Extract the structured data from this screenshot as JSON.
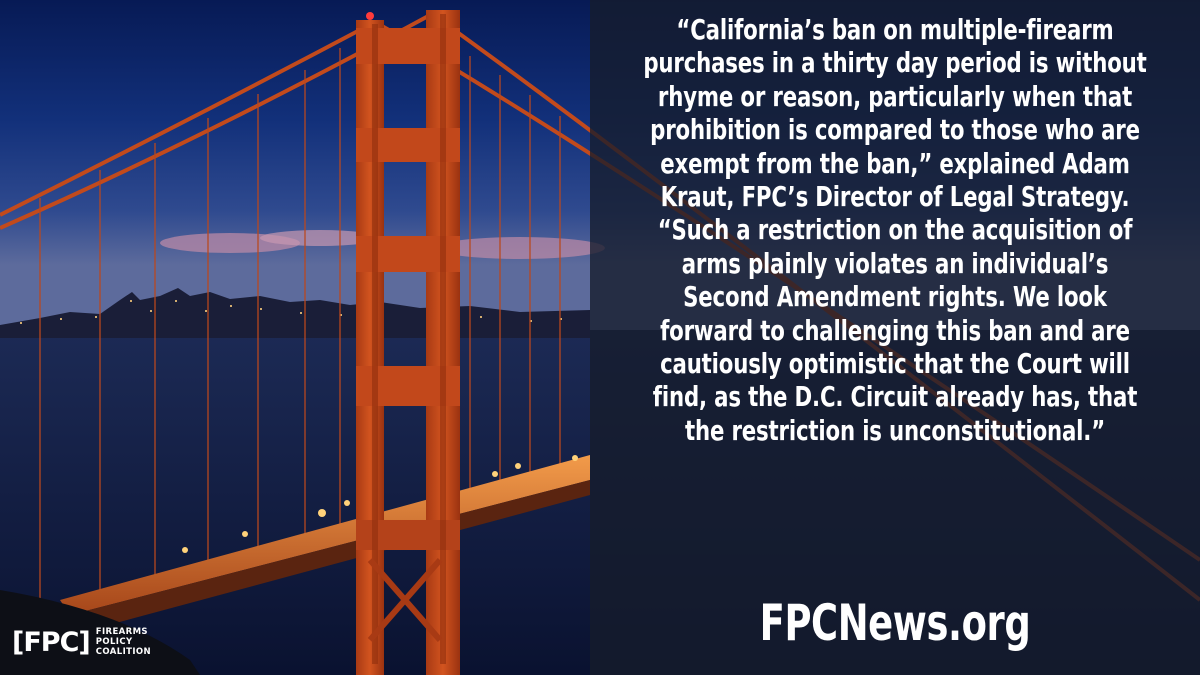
{
  "quote": {
    "text": "“California’s ban on multiple-firearm purchases in a thirty day period is without rhyme or reason, particularly when that prohibition is compared to those who are exempt from the ban,” explained Adam Kraut, FPC’s Director of Legal Strategy. “Such a restriction on the acquisition of arms plainly violates an individual’s Second Amendment rights. We look forward to challenging this ban and are cautiously optimistic that the Court will find, as the D.C. Circuit already has, that the restriction is unconstitutional.”"
  },
  "website": "FPCNews.org",
  "logo": {
    "mark": "[FPC]",
    "line1": "FIREARMS",
    "line2": "POLICY",
    "line3": "COALITION"
  },
  "colors": {
    "sky_top": "#0a1f5c",
    "sky_bottom": "#3d4f8a",
    "bridge": "#c7471c",
    "panel": "#161c2c",
    "text": "#ffffff"
  },
  "photo": {
    "subject": "golden-gate-bridge-at-dusk"
  }
}
